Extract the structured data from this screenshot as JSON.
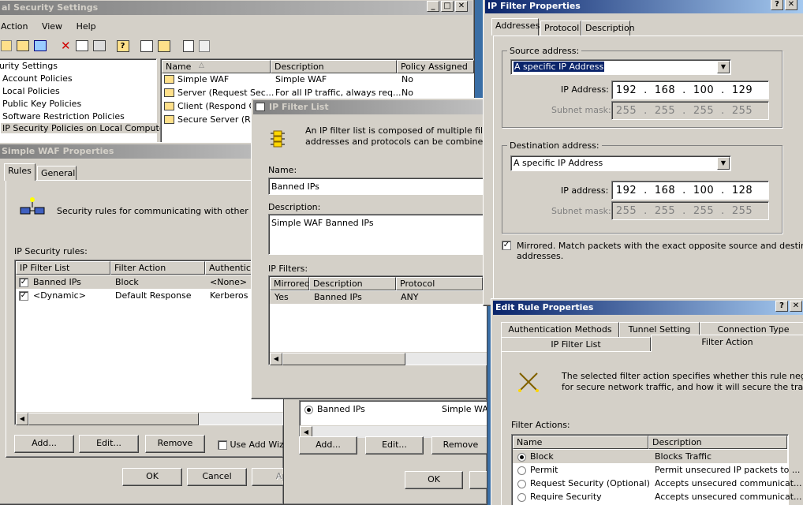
{
  "security_settings": {
    "title": "al Security Settings",
    "menu": [
      "Action",
      "View",
      "Help"
    ],
    "tree": [
      "urity Settings",
      "Account Policies",
      "Local Policies",
      "Public Key Policies",
      "Software Restriction Policies",
      "IP Security Policies on Local Computer"
    ],
    "list_headers": [
      "Name",
      "Description",
      "Policy Assigned"
    ],
    "list_rows": [
      {
        "name": "Simple WAF",
        "desc": "Simple WAF",
        "assigned": "No"
      },
      {
        "name": "Server (Request Sec...",
        "desc": "For all IP traffic, always req...",
        "assigned": "No"
      },
      {
        "name": "Client (Respond Or",
        "desc": "",
        "assigned": ""
      },
      {
        "name": "Secure Server (Re",
        "desc": "",
        "assigned": ""
      }
    ]
  },
  "waf_props": {
    "title": "Simple WAF Properties",
    "tabs": [
      "Rules",
      "General"
    ],
    "intro": "Security rules for communicating with other compute",
    "rules_label": "IP Security rules:",
    "headers": [
      "IP Filter List",
      "Filter Action",
      "Authentica"
    ],
    "rows": [
      {
        "list": "Banned IPs",
        "action": "Block",
        "auth": "<None>"
      },
      {
        "list": "<Dynamic>",
        "action": "Default Response",
        "auth": "Kerberos"
      }
    ],
    "buttons": {
      "add": "Add...",
      "edit": "Edit...",
      "remove": "Remove",
      "wizard": "Use Add Wiz",
      "ok": "OK",
      "cancel": "Cancel",
      "apply": "Ap"
    }
  },
  "middle_win": {
    "row_label": "Banned IPs",
    "row_desc": "Simple WAF",
    "buttons": {
      "add": "Add...",
      "edit": "Edit...",
      "remove": "Remove",
      "ok": "OK"
    }
  },
  "filter_list": {
    "title": "IP Filter List",
    "intro1": "An IP filter list is composed of multiple filters. In t",
    "intro2": "addresses and protocols can be combined into",
    "name_label": "Name:",
    "name_value": "Banned IPs",
    "desc_label": "Description:",
    "desc_value": "Simple WAF Banned IPs",
    "filters_label": "IP Filters:",
    "headers": [
      "Mirrored",
      "Description",
      "Protocol"
    ],
    "rows": [
      {
        "mirrored": "Yes",
        "desc": "Banned IPs",
        "protocol": "ANY"
      }
    ]
  },
  "filter_props": {
    "title": "IP Filter Properties",
    "tabs": [
      "Addresses",
      "Protocol",
      "Description"
    ],
    "source_group": "Source address:",
    "source_type": "A specific IP Address",
    "ip_label_src": "IP Address:",
    "src_ip": [
      "192",
      "168",
      "100",
      "129"
    ],
    "subnet_label": "Subnet mask:",
    "mask": [
      "255",
      "255",
      "255",
      "255"
    ],
    "dest_group": "Destination address:",
    "dest_type": "A specific IP Address",
    "ip_label_dst": "IP address:",
    "dst_ip": [
      "192",
      "168",
      "100",
      "128"
    ],
    "mirrored_text1": "Mirrored. Match packets with the exact opposite source and destination",
    "mirrored_text2": "addresses."
  },
  "edit_rule": {
    "title": "Edit Rule Properties",
    "tabs_top": [
      "Authentication Methods",
      "Tunnel Setting",
      "Connection Type"
    ],
    "tabs_bottom": [
      "IP Filter List",
      "Filter Action"
    ],
    "intro1": "The selected filter action specifies whether this rule negotiates",
    "intro2": "for secure network traffic, and how it will secure the traffic.",
    "actions_label": "Filter Actions:",
    "headers": [
      "Name",
      "Description"
    ],
    "rows": [
      {
        "name": "Block",
        "desc": "Blocks Traffic"
      },
      {
        "name": "Permit",
        "desc": "Permit unsecured IP packets to ..."
      },
      {
        "name": "Request Security (Optional)",
        "desc": "Accepts unsecured communicat..."
      },
      {
        "name": "Require Security",
        "desc": "Accepts unsecured communicat..."
      }
    ]
  }
}
